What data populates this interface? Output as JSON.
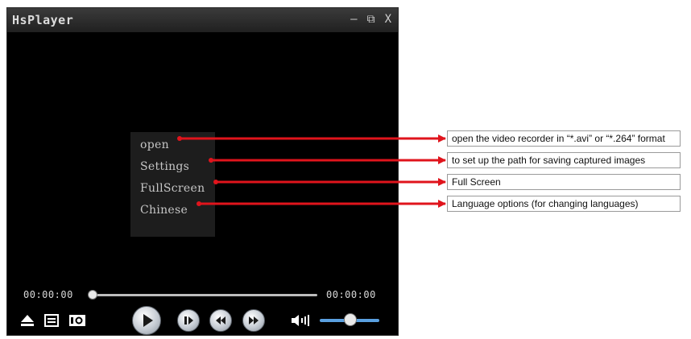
{
  "window": {
    "title": "HsPlayer",
    "minimize_label": "–",
    "restore_label": "⧉",
    "close_label": "X"
  },
  "context_menu": {
    "items": [
      {
        "label": "open"
      },
      {
        "label": "Settings"
      },
      {
        "label": "FullScreen"
      },
      {
        "label": "Chinese"
      }
    ]
  },
  "controls": {
    "time_current": "00:00:00",
    "time_total": "00:00:00",
    "icons": [
      "eject-icon",
      "playlist-icon",
      "snapshot-icon",
      "play-icon",
      "pause-icon",
      "rewind-icon",
      "fast-forward-icon",
      "volume-icon"
    ]
  },
  "annotations": [
    {
      "text": "open the video recorder in “*.avi” or “*.264” format"
    },
    {
      "text": "to set up the path for saving captured images"
    },
    {
      "text": "Full Screen"
    },
    {
      "text": "Language options (for changing languages)"
    }
  ],
  "colors": {
    "arrow": "#e0141c",
    "volume_fill": "#5aa0e0"
  }
}
